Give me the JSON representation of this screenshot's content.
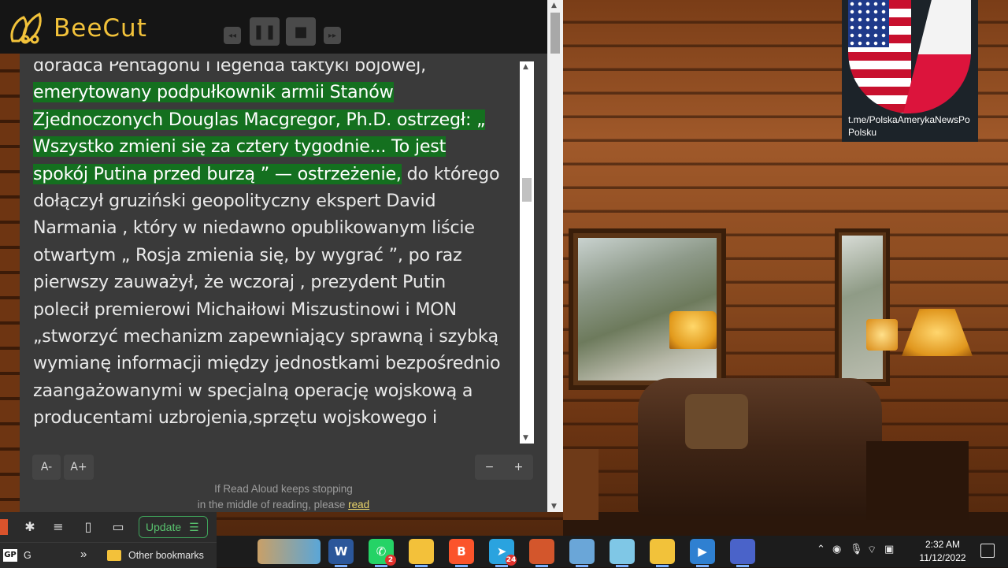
{
  "app": {
    "name": "BeeCut",
    "brand_color": "#f2c23a",
    "controls": {
      "rewind_icon": "rewind-icon",
      "pause_icon": "pause-icon",
      "stop_icon": "stop-icon",
      "forward_icon": "forward-icon"
    }
  },
  "reader": {
    "text_before": "doradca Pentagonu i legenda taktyki bojowej,",
    "highlighted": "emerytowany podpułkownik armii Stanów Zjednoczonych Douglas Macgregor, Ph.D. ostrzegł: „ Wszystko zmieni się za cztery tygodnie... To jest spokój Putina przed burzą ” — ostrzeżenie,",
    "text_after": " do którego dołączył gruziński geopolityczny ekspert David Narmania , który w niedawno opublikowanym liście otwartym „ Rosja zmienia się, by wygrać ”, po raz pierwszy zauważył, że wczoraj , prezydent Putin polecił premierowi Michaiłowi Miszustinowi i MON „stworzyć mechanizm zapewniający sprawną i szybką wymianę informacji między jednostkami bezpośrednio zaangażowanymi w specjalną operację wojskową a producentami uzbrojenia,sprzętu wojskowego i",
    "highlight_color": "#14701f",
    "font_decrease": "A-",
    "font_increase": "A+",
    "speed_decrease": "−",
    "speed_increase": "+",
    "note_line1": "If Read Aloud keeps stopping",
    "note_line2": "in the middle of reading, please ",
    "note_link": "read"
  },
  "telegram_badge": {
    "text": "t.me/PolskaAmerykaNewsPo Polsku"
  },
  "browser": {
    "update_label": "Update",
    "bookmark_gp": "GP",
    "bookmark_g": "G",
    "overflow": "»",
    "other_bookmarks": "Other bookmarks"
  },
  "taskbar": {
    "apps": [
      {
        "name": "word",
        "label": "W",
        "color": "#2b579a"
      },
      {
        "name": "whatsapp",
        "label": "✆",
        "color": "#25d366",
        "badge": "2"
      },
      {
        "name": "file-explorer",
        "label": "",
        "color": "#f3c13a"
      },
      {
        "name": "brave",
        "label": "B",
        "color": "#fb542b"
      },
      {
        "name": "telegram",
        "label": "➤",
        "color": "#2aa3df",
        "badge": "24"
      },
      {
        "name": "app-6",
        "label": "",
        "color": "#d3562c"
      },
      {
        "name": "app-7",
        "label": "",
        "color": "#6aa6d8"
      },
      {
        "name": "app-8",
        "label": "",
        "color": "#7fc7e6"
      },
      {
        "name": "beecut",
        "label": "",
        "color": "#f2c23a"
      },
      {
        "name": "app-10",
        "label": "▶",
        "color": "#2f80d1"
      },
      {
        "name": "app-11",
        "label": "",
        "color": "#4a63c9"
      }
    ],
    "time": "2:32 AM",
    "date": "11/12/2022"
  }
}
